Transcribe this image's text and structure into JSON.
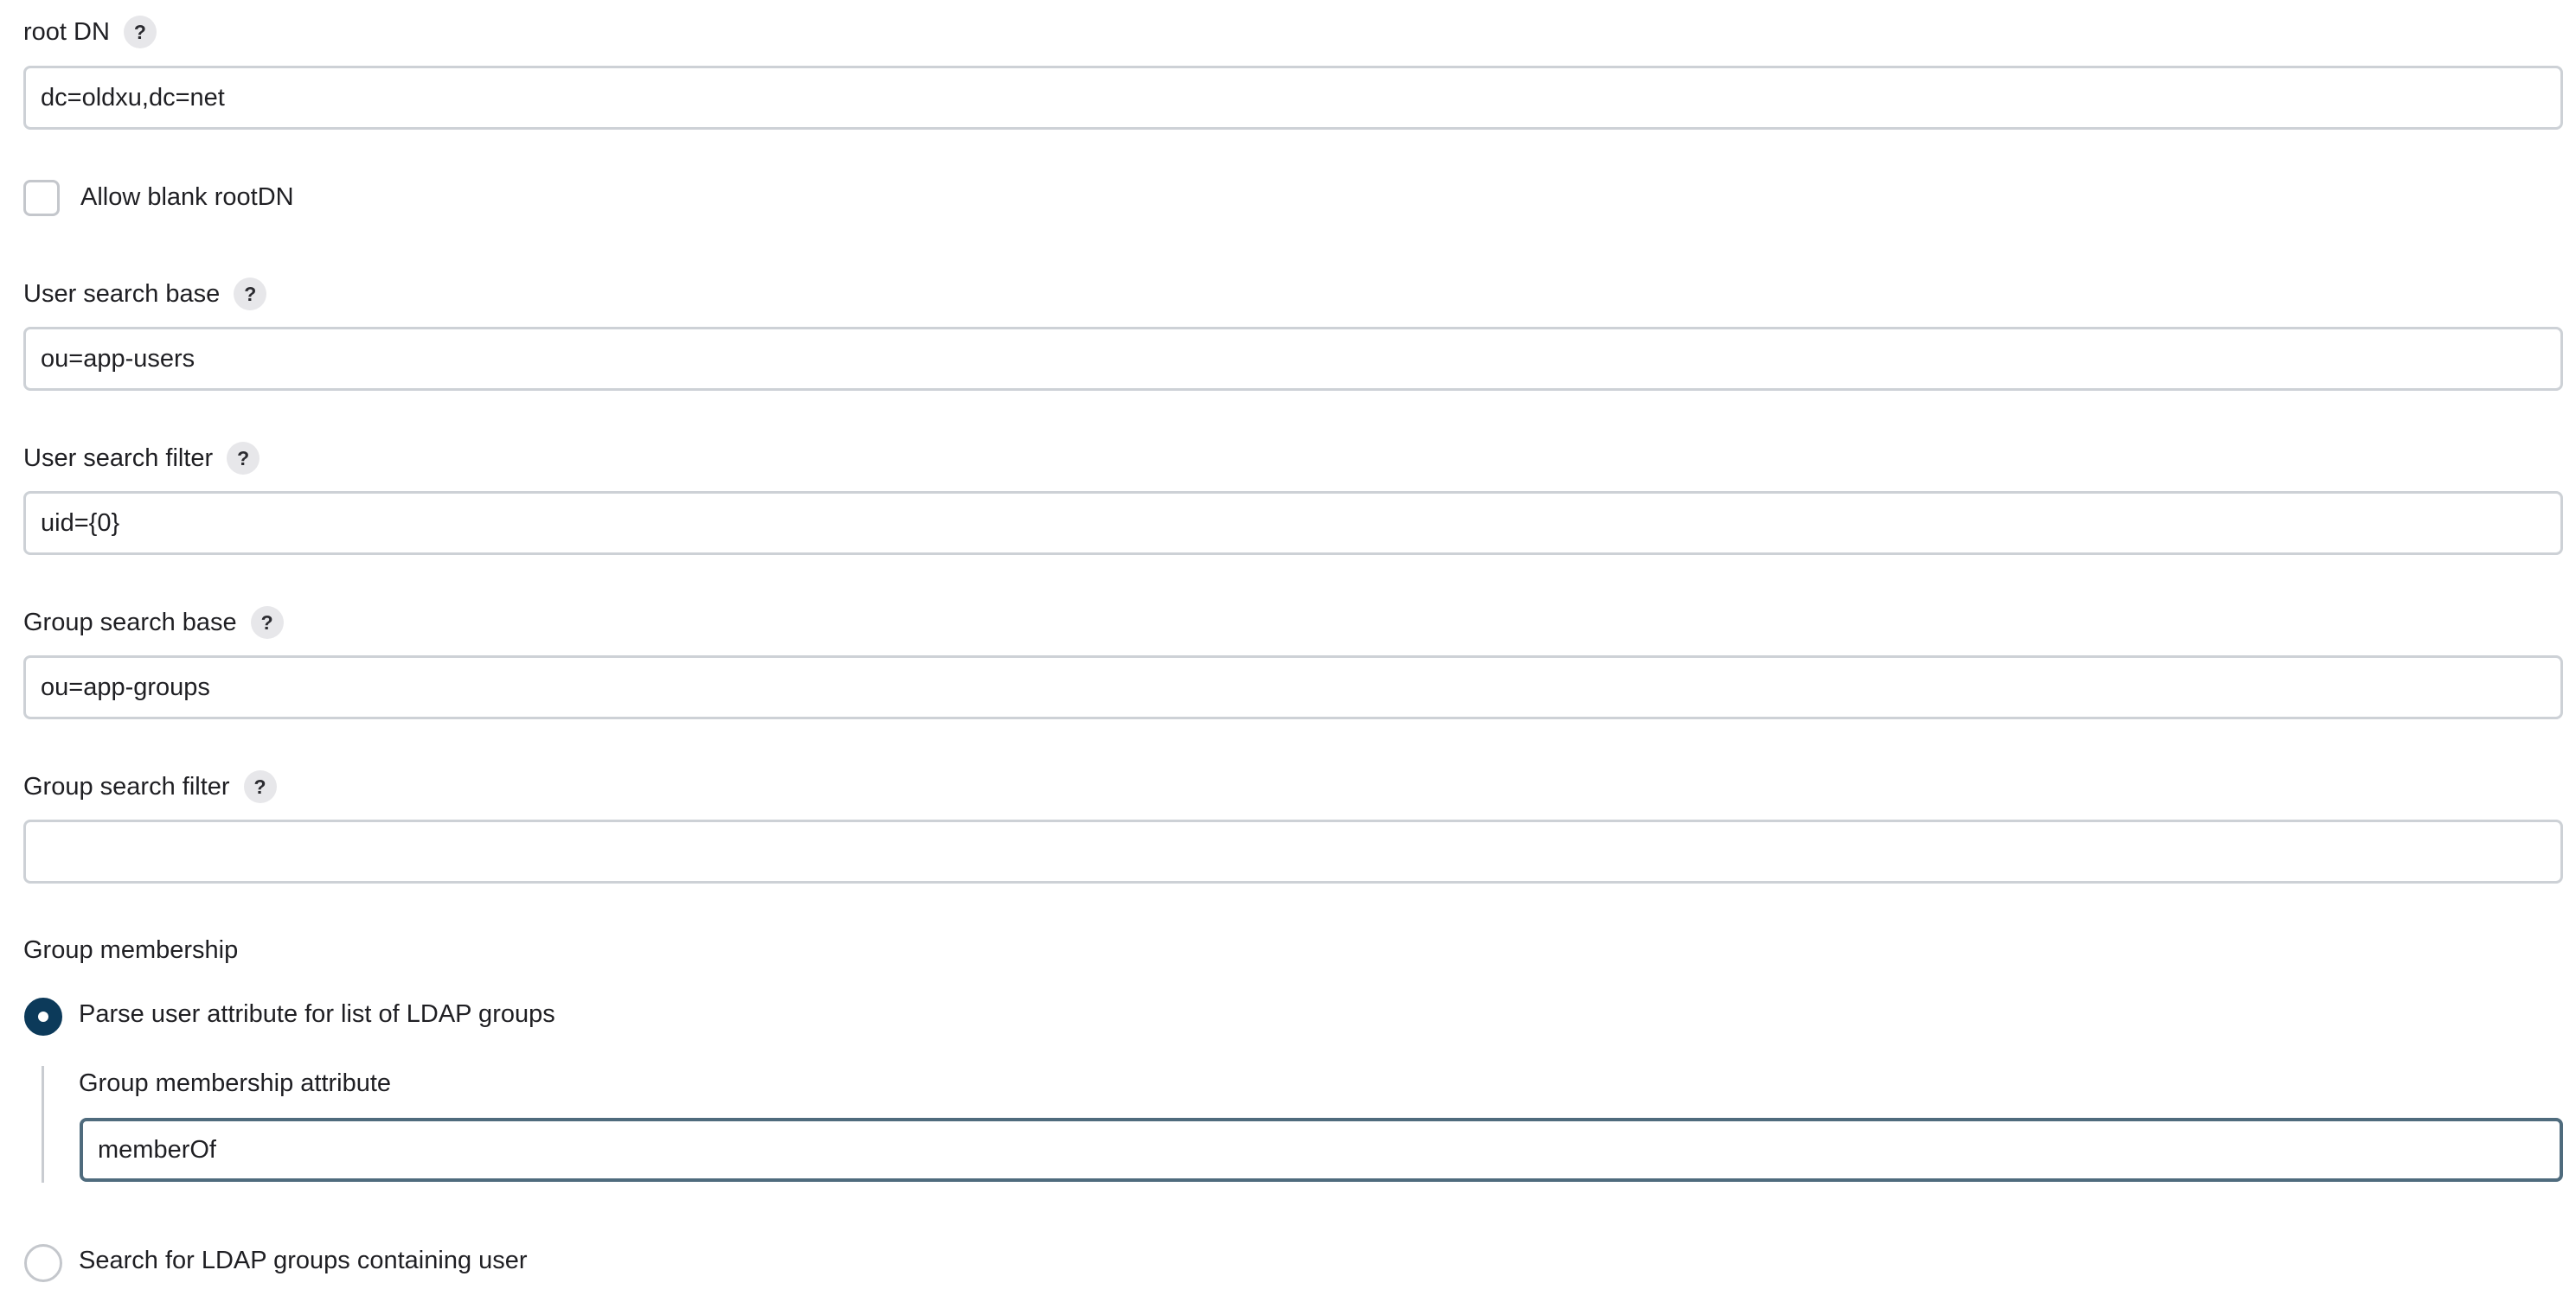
{
  "root_dn": {
    "label": "root DN",
    "value": "dc=oldxu,dc=net"
  },
  "allow_blank_rootdn": {
    "label": "Allow blank rootDN",
    "checked": false
  },
  "user_search_base": {
    "label": "User search base",
    "value": "ou=app-users"
  },
  "user_search_filter": {
    "label": "User search filter",
    "value": "uid={0}"
  },
  "group_search_base": {
    "label": "Group search base",
    "value": "ou=app-groups"
  },
  "group_search_filter": {
    "label": "Group search filter",
    "value": ""
  },
  "group_membership": {
    "label": "Group membership",
    "option_parse": {
      "label": "Parse user attribute for list of LDAP groups",
      "selected": true
    },
    "attribute": {
      "label": "Group membership attribute",
      "value": "memberOf"
    },
    "option_search": {
      "label": "Search for LDAP groups containing user",
      "selected": false
    }
  },
  "help_icon": {
    "glyph": "?",
    "icon": "help-icon"
  }
}
